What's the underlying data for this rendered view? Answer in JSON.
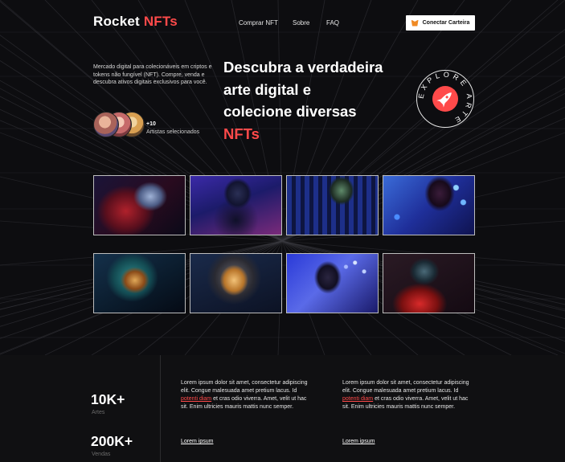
{
  "nav": {
    "logo_main": "Rocket",
    "logo_accent": "NFTs",
    "links": [
      "Comprar NFT",
      "Sobre",
      "FAQ"
    ],
    "wallet_button": "Conectar Carteira"
  },
  "hero": {
    "intro": "Mercado digital para colecionáveis em criptos e tokens não fungível (NFT). Compre, venda e descubra ativos digitais exclusivos para você.",
    "artists_count": "+10",
    "artists_label": "Artistas selecionados",
    "headline_lines": [
      "Descubra a verdadeira",
      "arte digital e",
      "colecione diversas"
    ],
    "headline_accent": "NFTs",
    "badge_text": "EXPLORE ARTE"
  },
  "gallery": [
    {
      "name": "astronaut-red-helmet"
    },
    {
      "name": "hooded-figure-blue"
    },
    {
      "name": "figure-city-lights"
    },
    {
      "name": "hooded-figure-bokeh"
    },
    {
      "name": "astronaut-teal-helmet"
    },
    {
      "name": "astronaut-gold-visor"
    },
    {
      "name": "hooded-figure-sparkles"
    },
    {
      "name": "astronaut-red-glow"
    }
  ],
  "stats": [
    {
      "value": "10K+",
      "label": "Artes"
    },
    {
      "value": "200K+",
      "label": "Vendas"
    }
  ],
  "info_columns": [
    {
      "text_before": "Lorem ipsum dolor sit amet, consectetur adipiscing elit. Congue malesuada amet pretium lacus. Id ",
      "link": "potenti diam",
      "text_after": " et cras odio viverra. Amet, velit ut hac sit. Enim ultricies mauris mattis nunc semper.",
      "footer_link": "Lorem ipsum"
    },
    {
      "text_before": "Lorem ipsum dolor sit amet, consectetur adipiscing elit. Congue malesuada amet pretium lacus. Id ",
      "link": "potenti diam",
      "text_after": " et cras odio viverra. Amet, velit ut hac sit. Enim ultricies mauris mattis nunc semper.",
      "footer_link": "Lorem ipsum"
    }
  ],
  "colors": {
    "accent": "#ff4a4a",
    "background": "#0d0d10",
    "stats_background": "#101012"
  }
}
